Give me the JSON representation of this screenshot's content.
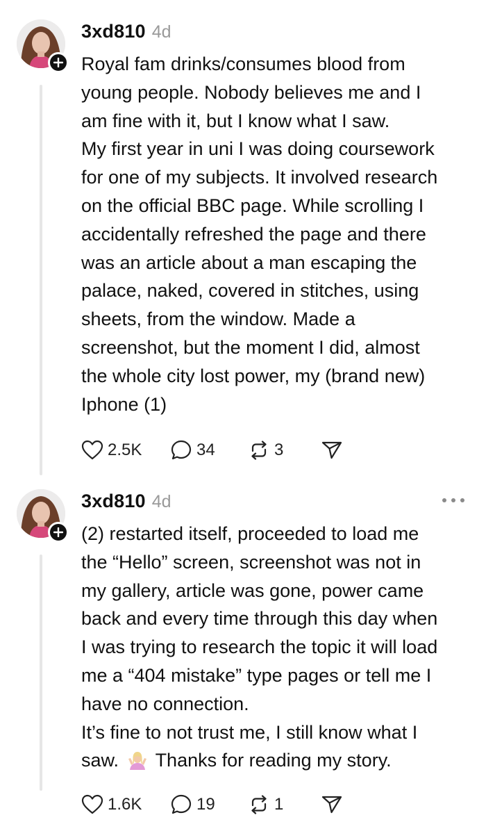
{
  "posts": [
    {
      "username": "3xd810",
      "time": "4d",
      "lines": [
        "Royal fam drinks/consumes blood from",
        "young people. Nobody believes me and I",
        "am fine with it, but I know what I saw.",
        "My first year in uni I was doing coursework",
        "for one of my subjects. It involved research",
        "on the official BBC page. While scrolling I",
        "accidentally refreshed the page and there",
        "was an article about a man escaping the",
        "palace, naked, covered in stitches, using",
        "sheets, from the window. Made a",
        "screenshot, but the moment I did, almost",
        "the whole city lost power, my (brand new)",
        "Iphone (1)"
      ],
      "likes": "2.5K",
      "replies": "34",
      "reposts": "3"
    },
    {
      "username": "3xd810",
      "time": "4d",
      "lines": [
        "(2) restarted itself, proceeded to load me",
        "the “Hello” screen, screenshot was not in",
        "my gallery, article was gone, power came",
        "back and every time through this day when",
        "I was trying to research the topic it will load",
        "me a “404 mistake” type pages or tell me I",
        "have no connection.",
        "It’s fine to not trust me, I still know what I"
      ],
      "last_line_before_emoji": "saw.",
      "last_line_after_emoji": "Thanks for reading my story.",
      "emoji_icon": "person-shrugging-emoji",
      "likes": "1.6K",
      "replies": "19",
      "reposts": "1"
    }
  ],
  "icons": {
    "like": "heart-icon",
    "reply": "comment-icon",
    "repost": "repost-icon",
    "share": "send-icon",
    "more": "more-dots-icon",
    "follow": "plus-icon"
  },
  "colors": {
    "text": "#111111",
    "muted": "#9a9a9a",
    "thread_line": "#e6e6e6",
    "badge": "#111111"
  }
}
